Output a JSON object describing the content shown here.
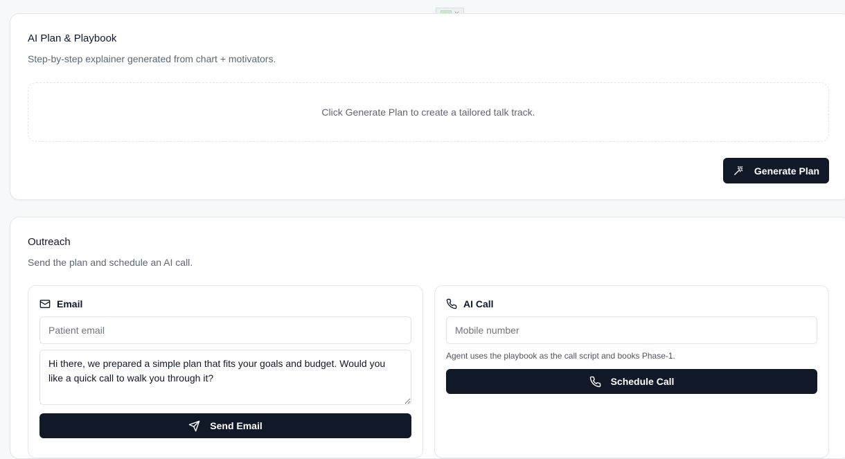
{
  "plan": {
    "title": "AI Plan & Playbook",
    "subtitle": "Step-by-step explainer generated from chart + motivators.",
    "empty_text": "Click Generate Plan to create a tailored talk track.",
    "generate_label": "Generate Plan"
  },
  "outreach": {
    "title": "Outreach",
    "subtitle": "Send the plan and schedule an AI call.",
    "email": {
      "heading": "Email",
      "placeholder": "Patient email",
      "message": "Hi there, we prepared a simple plan that fits your goals and budget. Would you like a quick call to walk you through it?",
      "send_label": "Send Email"
    },
    "call": {
      "heading": "AI Call",
      "placeholder": "Mobile number",
      "hint": "Agent uses the playbook as the call script and books Phase-1.",
      "schedule_label": "Schedule Call"
    }
  },
  "ad": {
    "close": "X"
  },
  "colors": {
    "button_bg": "#111827",
    "muted_text": "#5b6675"
  }
}
